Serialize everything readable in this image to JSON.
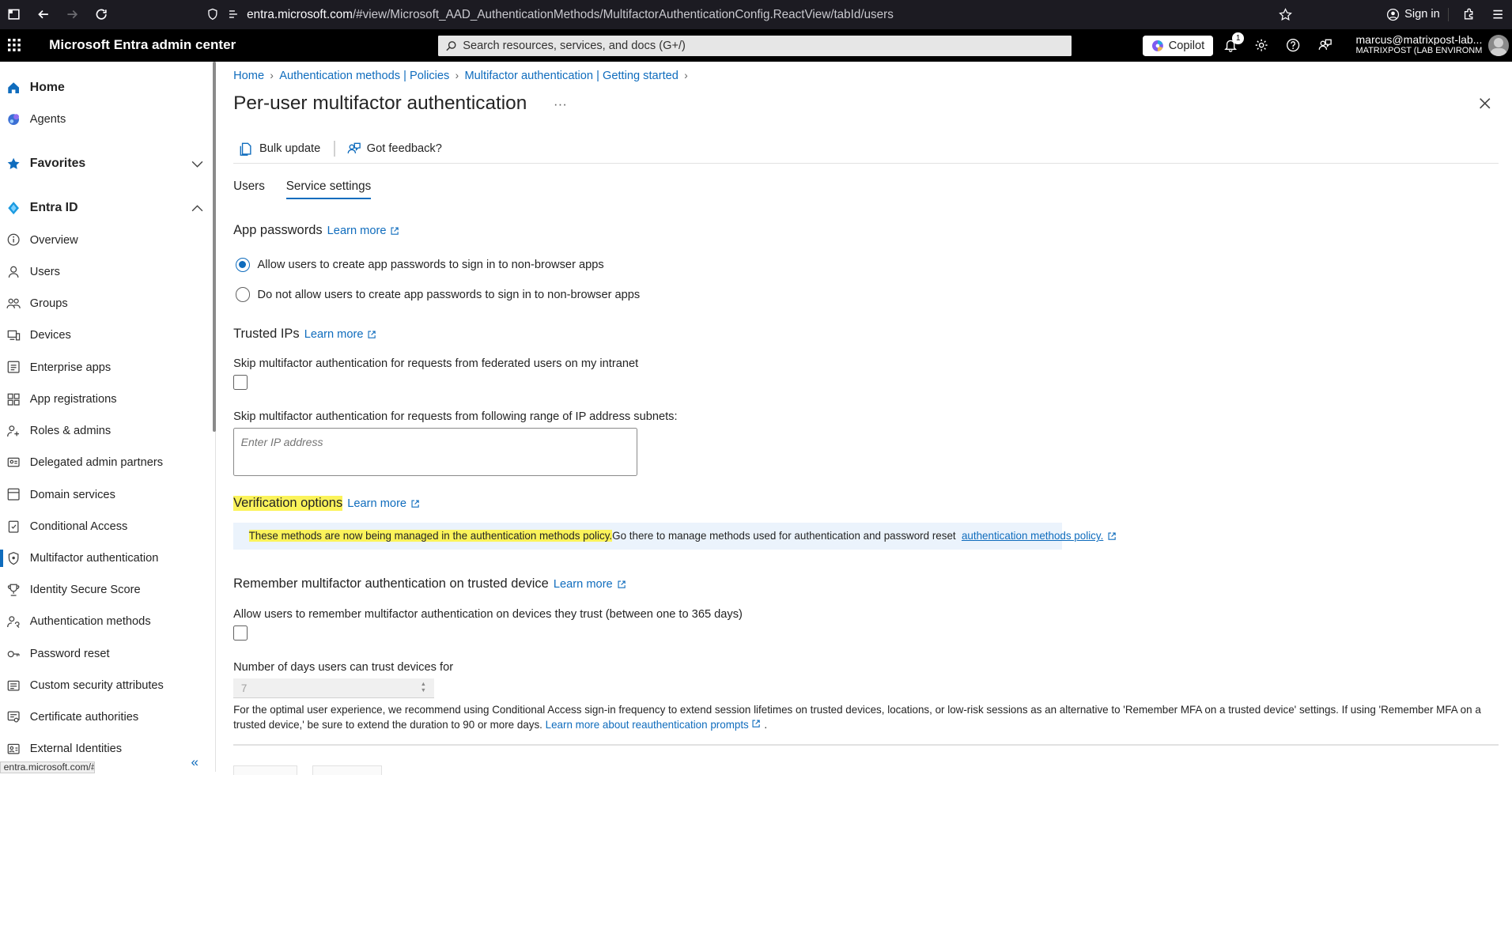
{
  "browser": {
    "url_host": "entra.microsoft.com",
    "url_path": "/#view/Microsoft_AAD_AuthenticationMethods/MultifactorAuthenticationConfig.ReactView/tabId/users",
    "sign_in": "Sign in",
    "status_url": "entra.microsoft.com/#"
  },
  "header": {
    "title": "Microsoft Entra admin center",
    "search_placeholder": "Search resources, services, and docs (G+/)",
    "copilot": "Copilot",
    "notification_count": "1",
    "account_name": "marcus@matrixpost-lab...",
    "account_tenant": "MATRIXPOST (LAB ENVIRONME..."
  },
  "sidebar": {
    "home": "Home",
    "agents": "Agents",
    "favorites": "Favorites",
    "entra_id": "Entra ID",
    "items": [
      "Overview",
      "Users",
      "Groups",
      "Devices",
      "Enterprise apps",
      "App registrations",
      "Roles & admins",
      "Delegated admin partners",
      "Domain services",
      "Conditional Access",
      "Multifactor authentication",
      "Identity Secure Score",
      "Authentication methods",
      "Password reset",
      "Custom security attributes",
      "Certificate authorities",
      "External Identities"
    ],
    "collapse": "«"
  },
  "main": {
    "breadcrumb": [
      "Home",
      "Authentication methods | Policies",
      "Multifactor authentication | Getting started"
    ],
    "title": "Per-user multifactor authentication",
    "more": "···",
    "toolbar": {
      "bulk_update": "Bulk update",
      "feedback": "Got feedback?"
    },
    "tabs": [
      "Users",
      "Service settings"
    ],
    "learn_more": "Learn more",
    "app_passwords": {
      "heading": "App passwords",
      "allow": "Allow users to create app passwords to sign in to non-browser apps",
      "deny": "Do not allow users to create app passwords to sign in to non-browser apps"
    },
    "trusted_ips": {
      "heading": "Trusted IPs",
      "skip_federated": "Skip multifactor authentication for requests from federated users on my intranet",
      "skip_range": "Skip multifactor authentication for requests from following range of IP address subnets:",
      "ip_placeholder": "Enter IP address"
    },
    "verification": {
      "heading": "Verification options",
      "info_highlighted": "These methods are now being managed in the authentication methods policy.",
      "info_rest": " Go there to manage methods used for authentication and password reset",
      "info_link": "authentication methods policy."
    },
    "remember": {
      "heading": "Remember multifactor authentication on trusted device",
      "allow": "Allow users to remember multifactor authentication on devices they trust (between one to 365 days)",
      "days_label": "Number of days users can trust devices for",
      "days_value": "7",
      "note": "For the optimal user experience, we recommend using Conditional Access sign-in frequency to extend session lifetimes on trusted devices, locations, or low-risk sessions as an alternative to 'Remember MFA on a trusted device' settings. If using 'Remember MFA on a trusted device,' be sure to extend the duration to 90 or more days.",
      "note_link": "Learn more about reauthentication prompts",
      "note_end": " ."
    }
  }
}
